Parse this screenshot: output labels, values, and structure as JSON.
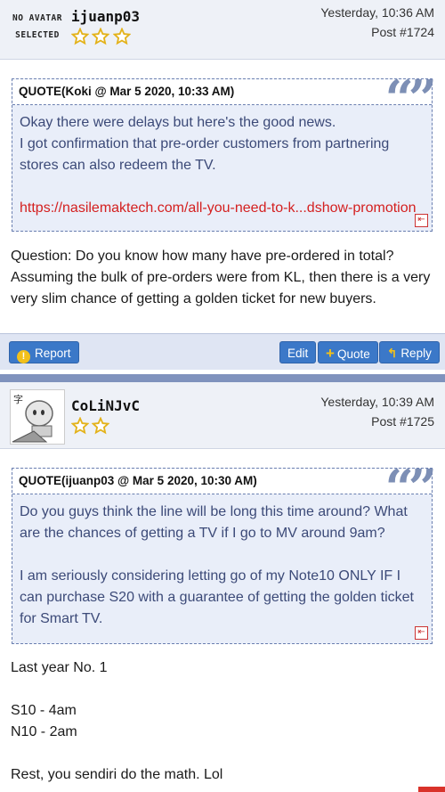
{
  "posts": [
    {
      "avatar_text": [
        "NO AVATAR",
        "SELECTED"
      ],
      "username": "ijuanp03",
      "timestamp": "Yesterday, 10:36 AM",
      "post_number": "Post #1724",
      "quote": {
        "title": "QUOTE(Koki @ Mar 5 2020, 10:33 AM)",
        "lines": [
          "Okay there were delays but here's the good news.",
          "I got confirmation that pre-order customers from partnering stores can also redeem the TV."
        ],
        "link": "https://nasilemaktech.com/all-you-need-to-k...dshow-promotion"
      },
      "text": [
        "Question: Do you know how many have pre-ordered in total? Assuming the bulk of pre-orders were from KL, then there is a very very slim chance of getting a golden ticket for new buyers."
      ],
      "actions": {
        "report": "Report",
        "edit": "Edit",
        "quote": "Quote",
        "reply": "Reply"
      }
    },
    {
      "username": "CoLiNJvC",
      "timestamp": "Yesterday, 10:39 AM",
      "post_number": "Post #1725",
      "quote": {
        "title": "QUOTE(ijuanp03 @ Mar 5 2020, 10:30 AM)",
        "lines": [
          "Do you guys think the line will be long this time around? What are the chances of getting a TV if I go to MV around 9am?",
          "I am seriously considering letting go of my Note10 ONLY IF I can purchase S20 with a guarantee of getting the golden ticket for Smart TV."
        ]
      },
      "text": [
        "Last year No. 1",
        "S10 - 4am",
        "N10 - 2am",
        "Rest, you sendiri do the math. Lol"
      ]
    }
  ],
  "colors": {
    "header_bg": "#eef1f7",
    "quote_text": "#3c4a78",
    "link": "#d42020",
    "button": "#3b78c8",
    "divider": "#7f92bd",
    "star": "#e3b21a"
  }
}
